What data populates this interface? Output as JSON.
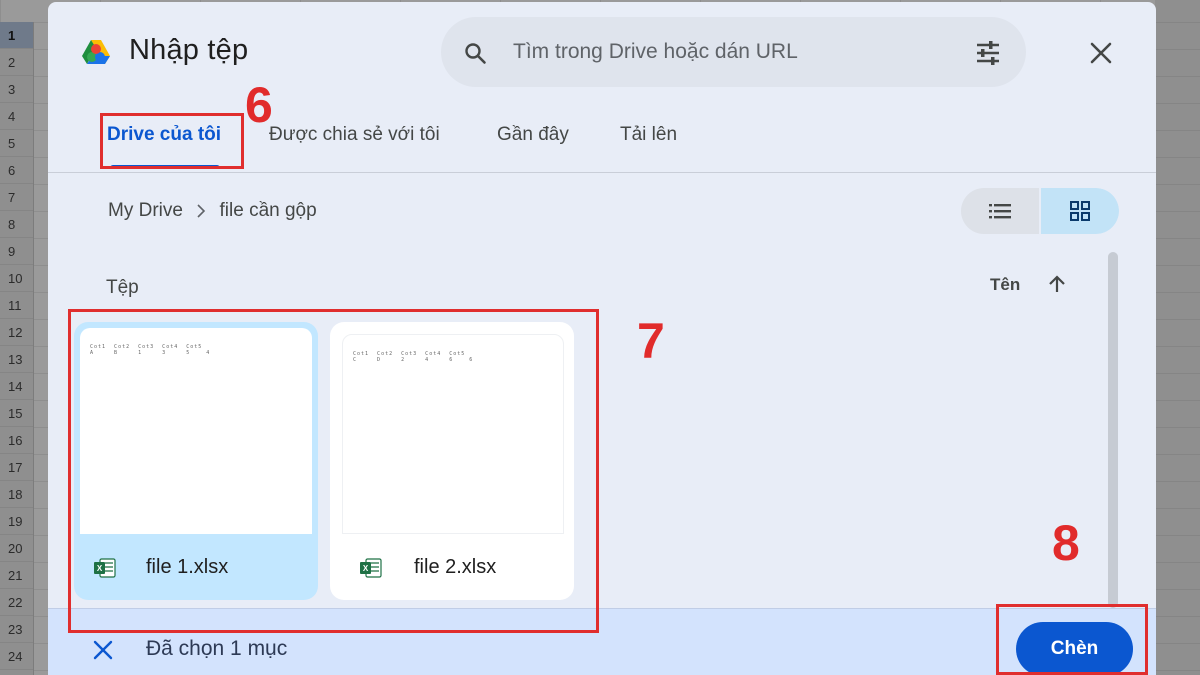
{
  "background": {
    "row_numbers": [
      "1",
      "2",
      "3",
      "4",
      "5",
      "6",
      "7",
      "8",
      "9",
      "10",
      "11",
      "12",
      "13",
      "14",
      "15",
      "16",
      "17",
      "18",
      "19",
      "20",
      "21",
      "22",
      "23",
      "24"
    ]
  },
  "dialog": {
    "title": "Nhập tệp",
    "search": {
      "placeholder": "Tìm trong Drive hoặc dán URL"
    },
    "tabs": [
      {
        "label": "Drive của tôi",
        "active": true
      },
      {
        "label": "Được chia sẻ với tôi",
        "active": false
      },
      {
        "label": "Gần đây",
        "active": false
      },
      {
        "label": "Tải lên",
        "active": false
      }
    ],
    "breadcrumb": [
      "My Drive",
      "file cần gộp"
    ],
    "section_label": "Tệp",
    "sort": {
      "label": "Tên",
      "direction": "ascending"
    },
    "files": [
      {
        "name": "file 1.xlsx",
        "selected": true,
        "icon": "excel-icon"
      },
      {
        "name": "file 2.xlsx",
        "selected": false,
        "icon": "excel-icon"
      }
    ],
    "selection_text": "Đã chọn 1 mục",
    "insert_label": "Chèn"
  },
  "annotations": [
    "6",
    "7",
    "8"
  ],
  "colors": {
    "accent": "#0b57d0",
    "selected_card": "#c2e7ff",
    "annotation_red": "#e02e2e",
    "excel_green": "#1e7145"
  }
}
